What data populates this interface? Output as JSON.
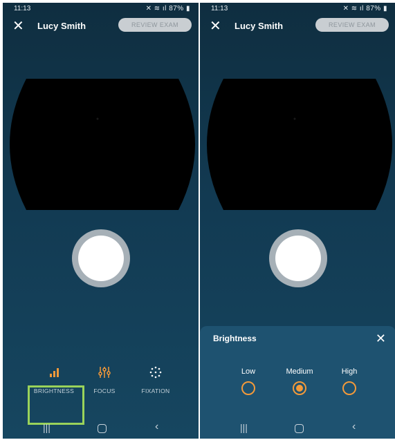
{
  "status": {
    "time": "11:13",
    "battery": "87%"
  },
  "header": {
    "patient_name": "Lucy Smith",
    "close_icon": "✕",
    "review_label": "REVIEW EXAM"
  },
  "toolbar": {
    "brightness_label": "BRIGHTNESS",
    "focus_label": "FOCUS",
    "fixation_label": "FIXATION"
  },
  "brightness_sheet": {
    "title": "Brightness",
    "close_icon": "✕",
    "options": [
      "Low",
      "Medium",
      "High"
    ],
    "selected": "Medium"
  },
  "nav": {
    "recents": "|||",
    "back": "‹"
  },
  "colors": {
    "accent": "#f39a3a",
    "highlight": "#9ad35a",
    "background": "#123a52"
  }
}
